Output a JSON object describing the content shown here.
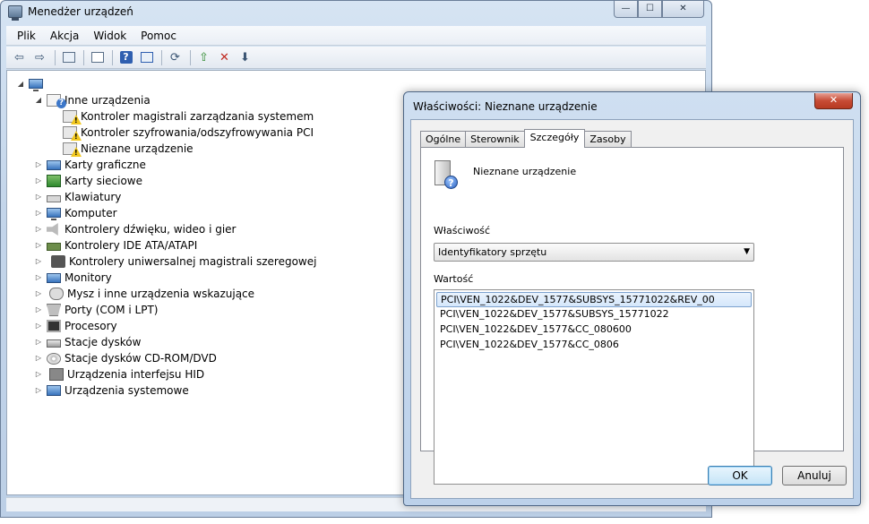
{
  "main_window": {
    "title": "Menedżer urządzeń",
    "caption_buttons": {
      "minimize": "—",
      "maximize": "☐",
      "close": "✕"
    },
    "menu": [
      "Plik",
      "Akcja",
      "Widok",
      "Pomoc"
    ],
    "toolbar_icons": [
      "back-icon",
      "forward-icon",
      "show-hide-tree-icon",
      "properties-icon",
      "help-icon",
      "view-icon",
      "update-driver-icon",
      "disable-icon",
      "uninstall-icon"
    ],
    "tree": {
      "root_icon": "computer-icon",
      "other_devices": {
        "label": "Inne urządzenia",
        "children": [
          "Kontroler magistrali zarządzania systemem",
          "Kontroler szyfrowania/odszyfrowywania PCI",
          "Nieznane urządzenie"
        ]
      },
      "categories": [
        {
          "label": "Karty graficzne",
          "icon": "display-adapter-icon"
        },
        {
          "label": "Karty sieciowe",
          "icon": "network-adapter-icon"
        },
        {
          "label": "Klawiatury",
          "icon": "keyboard-icon"
        },
        {
          "label": "Komputer",
          "icon": "computer-icon"
        },
        {
          "label": "Kontrolery dźwięku, wideo i gier",
          "icon": "sound-icon"
        },
        {
          "label": "Kontrolery IDE ATA/ATAPI",
          "icon": "ide-controller-icon"
        },
        {
          "label": "Kontrolery uniwersalnej magistrali szeregowej",
          "icon": "usb-icon"
        },
        {
          "label": "Monitory",
          "icon": "monitor-icon"
        },
        {
          "label": "Mysz i inne urządzenia wskazujące",
          "icon": "mouse-icon"
        },
        {
          "label": "Porty (COM i LPT)",
          "icon": "port-icon"
        },
        {
          "label": "Procesory",
          "icon": "processor-icon"
        },
        {
          "label": "Stacje dysków",
          "icon": "disk-drive-icon"
        },
        {
          "label": "Stacje dysków CD-ROM/DVD",
          "icon": "cd-drive-icon"
        },
        {
          "label": "Urządzenia interfejsu HID",
          "icon": "hid-icon"
        },
        {
          "label": "Urządzenia systemowe",
          "icon": "system-device-icon"
        }
      ]
    }
  },
  "dialog": {
    "title": "Właściwości: Nieznane urządzenie",
    "close_label": "✕",
    "tabs": [
      "Ogólne",
      "Sterownik",
      "Szczegóły",
      "Zasoby"
    ],
    "active_tab": "Szczegóły",
    "device_name": "Nieznane urządzenie",
    "property_label": "Właściwość",
    "property_selected": "Identyfikatory sprzętu",
    "value_label": "Wartość",
    "values": [
      "PCI\\VEN_1022&DEV_1577&SUBSYS_15771022&REV_00",
      "PCI\\VEN_1022&DEV_1577&SUBSYS_15771022",
      "PCI\\VEN_1022&DEV_1577&CC_080600",
      "PCI\\VEN_1022&DEV_1577&CC_0806"
    ],
    "ok_label": "OK",
    "cancel_label": "Anuluj"
  }
}
